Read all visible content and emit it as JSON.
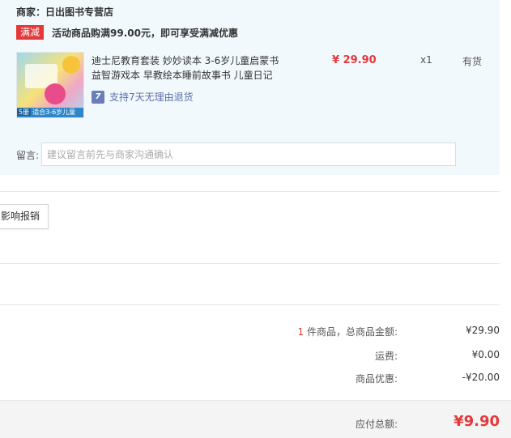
{
  "shop": {
    "name": "商家：日出图书专营店",
    "promo_tag": "满减",
    "promo_text": "活动商品购满99.00元，即可享受满减优惠"
  },
  "product": {
    "image_caption_volume": "5册",
    "image_caption_text": "适合3-6岁儿童",
    "title": "迪士尼教育套装 妙妙读本 3-6岁儿童启蒙书益智游戏本 早教绘本睡前故事书 儿童日记",
    "return_icon_glyph": "7",
    "return_policy": "支持7天无理由退货",
    "price": "¥ 29.90",
    "quantity": "x1",
    "stock": "有货"
  },
  "note": {
    "label": "留言:",
    "placeholder": "建议留言前先与商家沟通确认"
  },
  "invoice": {
    "button_label": "影响报销"
  },
  "summary": {
    "item_count": "1",
    "items_label": " 件商品，总商品金额:",
    "items_amount": "¥29.90",
    "shipping_label": "运费:",
    "shipping_amount": "¥0.00",
    "discount_label": "商品优惠:",
    "discount_amount": "-¥20.00",
    "total_label": "应付总额:",
    "total_amount": "¥9.90"
  },
  "colors": {
    "accent_red": "#e4393c",
    "panel_bg": "#f2f9fd",
    "link_blue": "#5a6fa8"
  }
}
